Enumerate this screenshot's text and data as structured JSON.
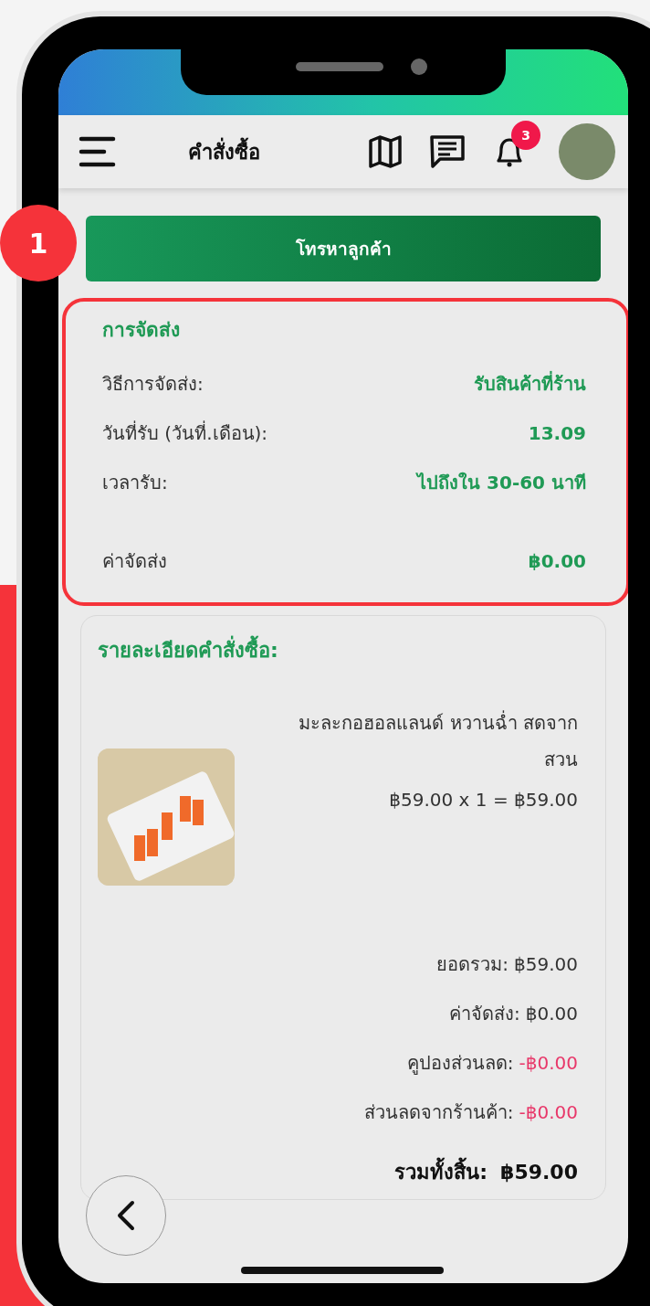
{
  "header": {
    "title": "คำสั่งซื้อ",
    "notification_count": "3"
  },
  "step_marker": "1",
  "call_button": {
    "label": "โทรหาลูกค้า"
  },
  "delivery": {
    "title": "การจัดส่ง",
    "rows": [
      {
        "label": "วิธีการจัดส่ง:",
        "value": "รับสินค้าที่ร้าน"
      },
      {
        "label": "วันที่รับ (วันที่.เดือน):",
        "value": "13.09"
      },
      {
        "label": "เวลารับ:",
        "value": "ไปถึงใน 30-60 นาที"
      }
    ],
    "fee": {
      "label": "ค่าจัดส่ง",
      "value": "฿0.00"
    }
  },
  "order": {
    "title": "รายละเอียดคำสั่งซื้อ:",
    "items": [
      {
        "name": "มะละกอฮอลแลนด์ หวานฉ่ำ สดจาก สวน",
        "price_line": "฿59.00 x 1 = ฿59.00"
      }
    ],
    "summary": [
      {
        "kind": "charge",
        "label": "ยอดรวม:",
        "value": "฿59.00"
      },
      {
        "kind": "charge",
        "label": "ค่าจัดส่ง:",
        "value": "฿0.00"
      },
      {
        "kind": "discount",
        "label": "คูปองส่วนลด:",
        "value": "-฿0.00"
      },
      {
        "kind": "discount",
        "label": "ส่วนลดจากร้านค้า:",
        "value": "-฿0.00"
      }
    ],
    "total": {
      "label": "รวมทั้งสิ้น:",
      "value": "฿59.00"
    }
  }
}
